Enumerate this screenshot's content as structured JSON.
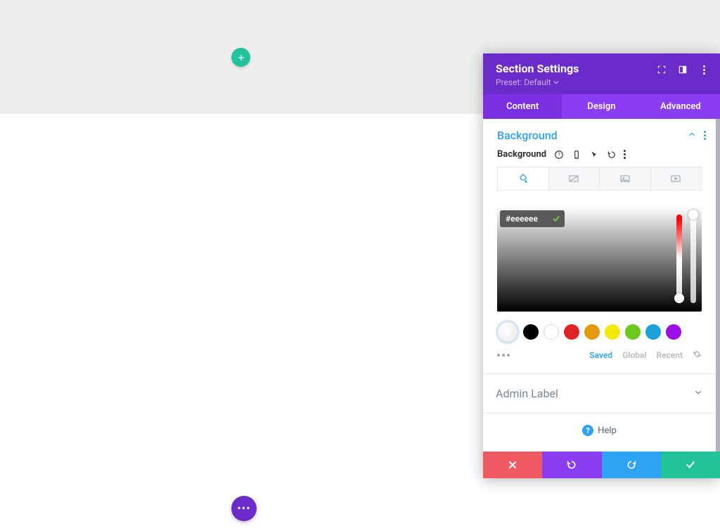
{
  "panel": {
    "title": "Section Settings",
    "preset": "Preset: Default",
    "tabs": [
      "Content",
      "Design",
      "Advanced"
    ],
    "active_tab": 0
  },
  "background": {
    "section_title": "Background",
    "label": "Background",
    "hex_value": "#eeeeee",
    "swatches": [
      "#000000",
      "#ffffff",
      "#e02424",
      "#e39b0e",
      "#f2e90a",
      "#6dc81e",
      "#1ba2dd",
      "#9b10e8"
    ],
    "meta": {
      "saved": "Saved",
      "global": "Global",
      "recent": "Recent"
    }
  },
  "admin_label": {
    "title": "Admin Label"
  },
  "help": {
    "label": "Help"
  }
}
